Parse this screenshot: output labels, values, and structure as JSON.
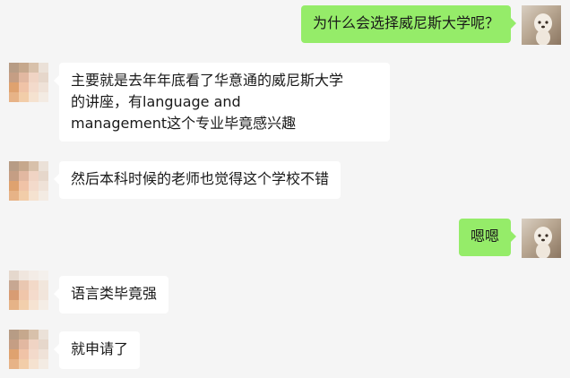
{
  "messages": [
    {
      "side": "right",
      "text": "为什么会选择威尼斯大学呢？"
    },
    {
      "side": "left",
      "lines": [
        "主要就是去年年底看了华意通的威尼斯大学",
        "的讲座，有language and",
        "management这个专业毕竟感兴趣"
      ]
    },
    {
      "side": "left",
      "text": "然后本科时候的老师也觉得这个学校不错"
    },
    {
      "side": "right",
      "text": "嗯嗯"
    },
    {
      "side": "left",
      "text": "语言类毕竟强"
    },
    {
      "side": "left",
      "text": "就申请了"
    }
  ],
  "colors": {
    "background": "#f5f5f5",
    "bubble_self": "#95ec69",
    "bubble_other": "#ffffff"
  }
}
